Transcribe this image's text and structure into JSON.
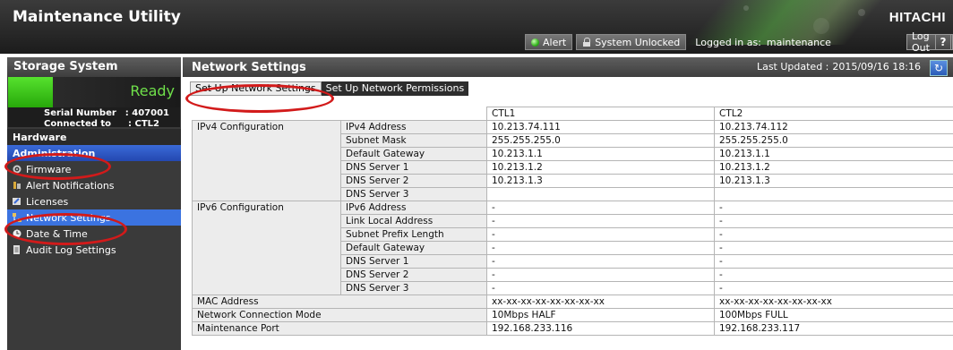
{
  "header": {
    "app_title": "Maintenance Utility",
    "brand": "HITACHI",
    "alert_label": "Alert",
    "lock_label": "System Unlocked",
    "logged_in_label": "Logged in as:",
    "username": "maintenance",
    "logout_label": "Log Out",
    "help_label": "?"
  },
  "sidebar": {
    "title": "Storage System",
    "status": "Ready",
    "serial_label": "Serial Number",
    "serial_value": ": 407001",
    "connected_label": "Connected to",
    "connected_value": ": CTL2",
    "items": [
      {
        "label": "Hardware",
        "icon": "section-header"
      },
      {
        "label": "Administration",
        "icon": "section-header"
      },
      {
        "label": "Firmware",
        "icon": "firmware-icon"
      },
      {
        "label": "Alert Notifications",
        "icon": "alert-notifications-icon"
      },
      {
        "label": "Licenses",
        "icon": "licenses-icon"
      },
      {
        "label": "Network Settings",
        "icon": "network-settings-icon"
      },
      {
        "label": "Date & Time",
        "icon": "clock-icon"
      },
      {
        "label": "Audit Log Settings",
        "icon": "audit-log-icon"
      }
    ]
  },
  "main": {
    "title": "Network Settings",
    "last_updated_label": "Last Updated :",
    "last_updated_value": "2015/09/16 18:16",
    "refresh_icon": "refresh-icon",
    "tabs": [
      {
        "label": "Set Up Network Settings",
        "active": true
      },
      {
        "label": "Set Up Network Permissions",
        "active": false
      }
    ],
    "columns": [
      "CTL1",
      "CTL2"
    ],
    "ipv4": {
      "group": "IPv4 Configuration",
      "rows": [
        {
          "label": "IPv4 Address",
          "ctl1": "10.213.74.111",
          "ctl2": "10.213.74.112"
        },
        {
          "label": "Subnet Mask",
          "ctl1": "255.255.255.0",
          "ctl2": "255.255.255.0"
        },
        {
          "label": "Default Gateway",
          "ctl1": "10.213.1.1",
          "ctl2": "10.213.1.1"
        },
        {
          "label": "DNS Server 1",
          "ctl1": "10.213.1.2",
          "ctl2": "10.213.1.2"
        },
        {
          "label": "DNS Server 2",
          "ctl1": "10.213.1.3",
          "ctl2": "10.213.1.3"
        },
        {
          "label": "DNS Server 3",
          "ctl1": "",
          "ctl2": ""
        }
      ]
    },
    "ipv6": {
      "group": "IPv6 Configuration",
      "rows": [
        {
          "label": "IPv6 Address",
          "ctl1": "-",
          "ctl2": "-"
        },
        {
          "label": "Link Local Address",
          "ctl1": "-",
          "ctl2": "-"
        },
        {
          "label": "Subnet Prefix Length",
          "ctl1": "-",
          "ctl2": "-"
        },
        {
          "label": "Default Gateway",
          "ctl1": "-",
          "ctl2": "-"
        },
        {
          "label": "DNS Server 1",
          "ctl1": "-",
          "ctl2": "-"
        },
        {
          "label": "DNS Server 2",
          "ctl1": "-",
          "ctl2": "-"
        },
        {
          "label": "DNS Server 3",
          "ctl1": "-",
          "ctl2": "-"
        }
      ]
    },
    "other_rows": [
      {
        "label": "MAC Address",
        "ctl1": "xx-xx-xx-xx-xx-xx-xx-xx",
        "ctl2": "xx-xx-xx-xx-xx-xx-xx-xx"
      },
      {
        "label": "Network Connection Mode",
        "ctl1": "10Mbps HALF",
        "ctl2": "100Mbps FULL"
      },
      {
        "label": "Maintenance Port",
        "ctl1": "192.168.233.116",
        "ctl2": "192.168.233.117"
      }
    ]
  },
  "colors": {
    "annotation_red": "#d21a1a",
    "ready_green": "#6fe04a",
    "selected_blue": "#3b73e0"
  }
}
